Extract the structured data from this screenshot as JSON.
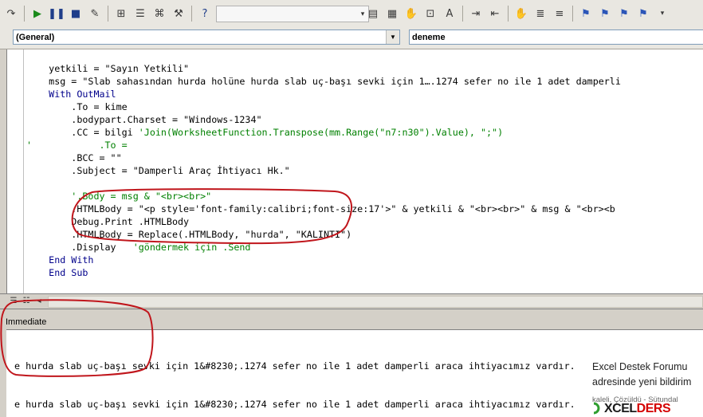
{
  "toolbar": {
    "icons": [
      "redo-icon",
      "run-icon",
      "break-icon",
      "reset-icon",
      "design-mode-icon",
      "project-explorer-icon",
      "properties-icon",
      "object-browser-icon",
      "toolbox-icon",
      "help-icon",
      "indent-icon",
      "outdent-icon",
      "toggle-breakpoint-icon",
      "comment-block-icon",
      "uncomment-block-icon",
      "toggle-bookmark-icon",
      "next-bookmark-icon",
      "prev-bookmark-icon",
      "clear-bookmarks-icon"
    ]
  },
  "combos": {
    "object": "(General)",
    "procedure": "deneme"
  },
  "code": {
    "lines": [
      {
        "text": "yetkili = \"Sayın Yetkili\"",
        "indent": "    ",
        "type": "code"
      },
      {
        "text": "msg = \"Slab sahasından hurda holüne hurda slab uç-başı sevki için 1….1274 sefer no ile 1 adet damperli",
        "indent": "    ",
        "type": "code"
      },
      {
        "text": "With OutMail",
        "indent": "    ",
        "type": "kw"
      },
      {
        "text": ".To = kime",
        "indent": "        ",
        "type": "code"
      },
      {
        "text": ".bodypart.Charset = \"Windows-1234\"",
        "indent": "        ",
        "type": "code"
      },
      {
        "text": ".CC = bilgi",
        "comment": " 'Join(WorksheetFunction.Transpose(mm.Range(\"n7:n30\").Value), \";\")",
        "indent": "        ",
        "type": "mixed"
      },
      {
        "text": "'            .To =",
        "indent": "",
        "type": "cmt"
      },
      {
        "text": ".BCC = \"\"",
        "indent": "        ",
        "type": "code"
      },
      {
        "text": ".Subject = \"Damperli Araç İhtiyacı Hk.\"",
        "indent": "        ",
        "type": "code"
      },
      {
        "text": "",
        "indent": "",
        "type": "code"
      },
      {
        "text": "'.Body = msg & \"<br><br>\"",
        "indent": "        ",
        "type": "cmt"
      },
      {
        "text": ".HTMLBody = \"<p style='font-family:calibri;font-size:17'>\" & yetkili & \"<br><br>\" & msg & \"<br><b",
        "indent": "        ",
        "type": "code"
      },
      {
        "text": "Debug.Print .HTMLBody",
        "indent": "        ",
        "type": "code"
      },
      {
        "text": ".HTMLBody = Replace(.HTMLBody, \"hurda\", \"KALINTI\")",
        "indent": "        ",
        "type": "code"
      },
      {
        "text": ".Display",
        "comment": "   'göndermek için .Send",
        "indent": "        ",
        "type": "mixed"
      },
      {
        "text": "End With",
        "indent": "    ",
        "type": "kw"
      },
      {
        "text": "End Sub",
        "indent": "    ",
        "type": "kw"
      }
    ]
  },
  "immediate": {
    "title": "Immediate",
    "lines": [
      "e hurda slab uç-başı sevki için 1&#8230;.1274 sefer no ile 1 adet damperli araca ihtiyacımız vardır. Konu ha",
      "e hurda slab uç-başı sevki için 1&#8230;.1274 sefer no ile 1 adet damperli araca ihtiyacımız vardır. Konu ha"
    ]
  },
  "notification": {
    "title": "Excel Destek Forumu",
    "body": "adresinde yeni bildirim",
    "detail": "kaleli, Çözüldü - Sütundal",
    "brand_prefix": "XCEL",
    "brand_suffix": "DERS"
  },
  "colors": {
    "annotation_circle": "#c0161c",
    "comment_green": "#008000",
    "keyword_blue": "#00008b"
  }
}
